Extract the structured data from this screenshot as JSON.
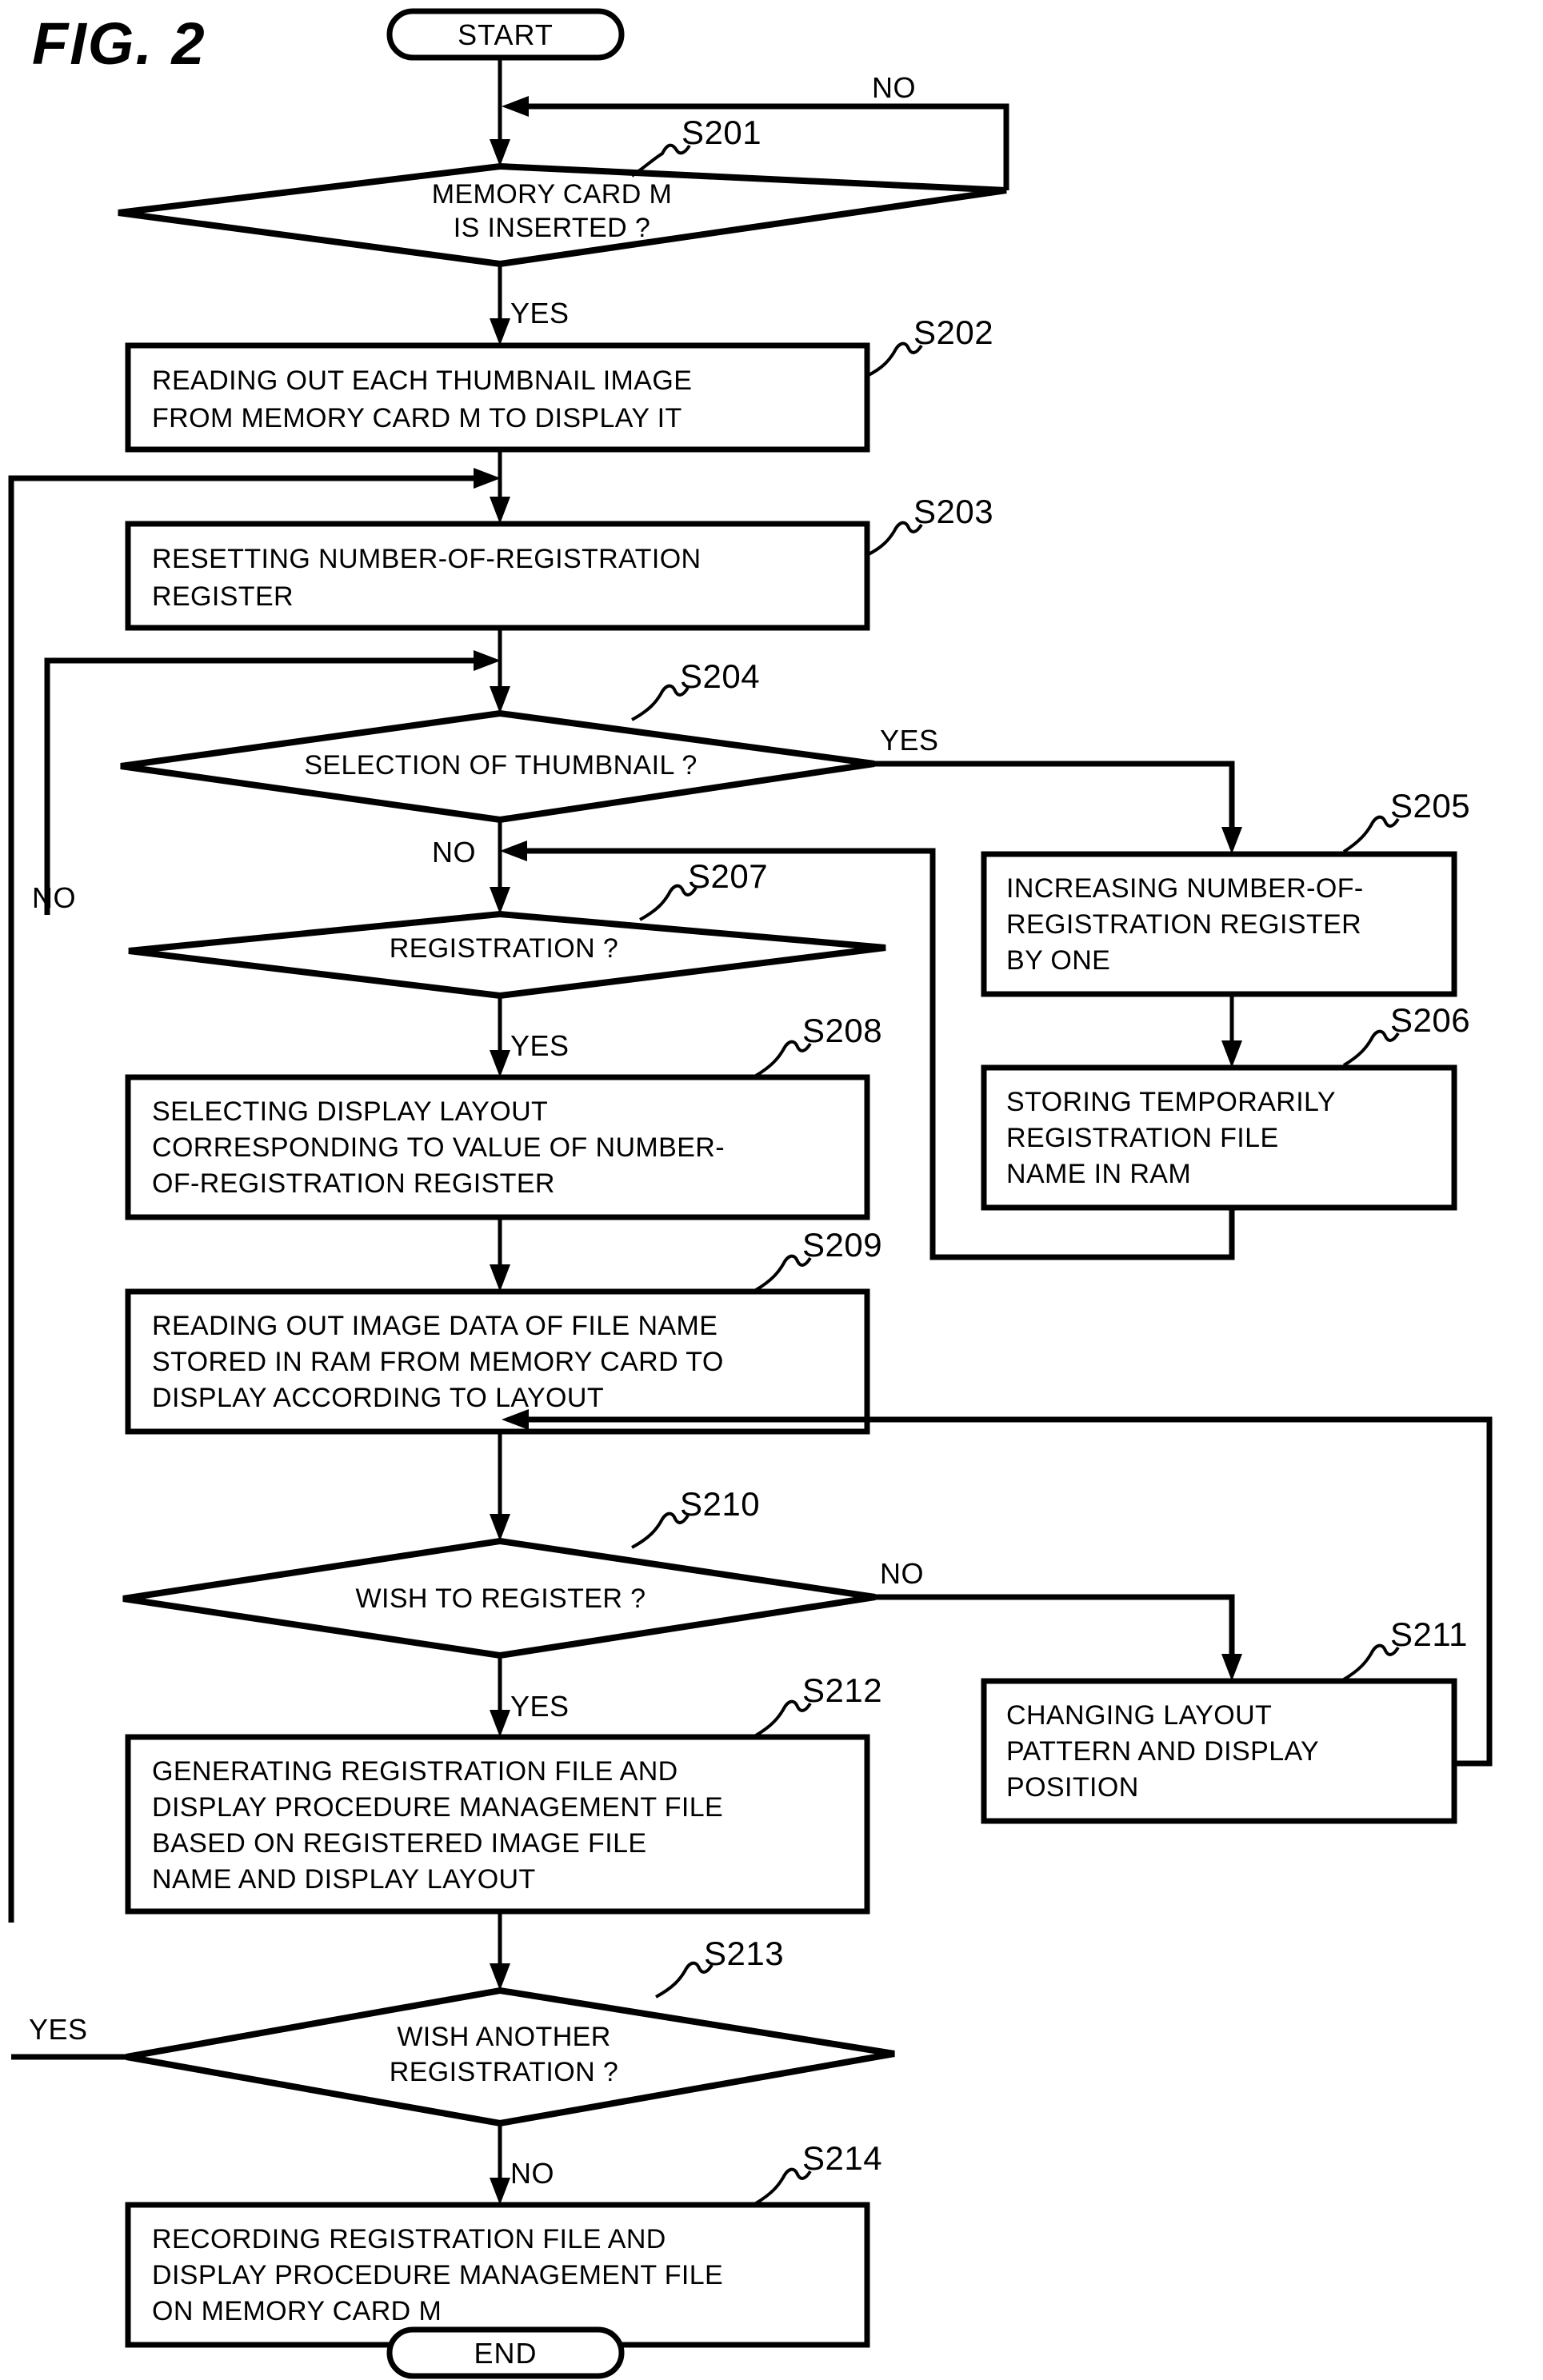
{
  "figure": {
    "label": "FIG. 2",
    "type": "flowchart"
  },
  "terminals": {
    "start": "START",
    "end": "END"
  },
  "nodes": [
    {
      "id": "S201",
      "step": "S201",
      "shape": "decision",
      "lines": [
        "MEMORY CARD M",
        "IS INSERTED ?"
      ]
    },
    {
      "id": "S202",
      "step": "S202",
      "shape": "process",
      "lines": [
        "READING OUT EACH THUMBNAIL IMAGE",
        "FROM MEMORY CARD M TO DISPLAY IT"
      ]
    },
    {
      "id": "S203",
      "step": "S203",
      "shape": "process",
      "lines": [
        "RESETTING NUMBER-OF-REGISTRATION",
        "REGISTER"
      ]
    },
    {
      "id": "S204",
      "step": "S204",
      "shape": "decision",
      "lines": [
        "SELECTION OF THUMBNAIL ?"
      ]
    },
    {
      "id": "S205",
      "step": "S205",
      "shape": "process",
      "lines": [
        "INCREASING NUMBER-OF-",
        "REGISTRATION REGISTER",
        "BY ONE"
      ]
    },
    {
      "id": "S206",
      "step": "S206",
      "shape": "process",
      "lines": [
        "STORING TEMPORARILY",
        "REGISTRATION FILE",
        "NAME IN RAM"
      ]
    },
    {
      "id": "S207",
      "step": "S207",
      "shape": "decision",
      "lines": [
        "REGISTRATION ?"
      ]
    },
    {
      "id": "S208",
      "step": "S208",
      "shape": "process",
      "lines": [
        "SELECTING DISPLAY LAYOUT",
        "CORRESPONDING TO VALUE OF NUMBER-",
        "OF-REGISTRATION REGISTER"
      ]
    },
    {
      "id": "S209",
      "step": "S209",
      "shape": "process",
      "lines": [
        "READING OUT IMAGE DATA OF FILE NAME",
        "STORED IN RAM FROM MEMORY CARD TO",
        "DISPLAY ACCORDING TO LAYOUT"
      ]
    },
    {
      "id": "S210",
      "step": "S210",
      "shape": "decision",
      "lines": [
        "WISH TO REGISTER ?"
      ]
    },
    {
      "id": "S211",
      "step": "S211",
      "shape": "process",
      "lines": [
        "CHANGING LAYOUT",
        "PATTERN AND DISPLAY",
        "POSITION"
      ]
    },
    {
      "id": "S212",
      "step": "S212",
      "shape": "process",
      "lines": [
        "GENERATING REGISTRATION FILE AND",
        "DISPLAY PROCEDURE MANAGEMENT FILE",
        "BASED ON REGISTERED IMAGE FILE",
        "NAME AND DISPLAY LAYOUT"
      ]
    },
    {
      "id": "S213",
      "step": "S213",
      "shape": "decision",
      "lines": [
        "WISH ANOTHER",
        "REGISTRATION ?"
      ]
    },
    {
      "id": "S214",
      "step": "S214",
      "shape": "process",
      "lines": [
        "RECORDING REGISTRATION FILE AND",
        "DISPLAY PROCEDURE MANAGEMENT FILE",
        "ON MEMORY CARD M"
      ]
    }
  ],
  "edge_labels": {
    "s201_no": "NO",
    "s201_yes": "YES",
    "s204_yes": "YES",
    "s204_no": "NO",
    "s207_no": "NO",
    "s207_yes": "YES",
    "s210_no": "NO",
    "s210_yes": "YES",
    "s213_yes": "YES",
    "s213_no": "NO"
  },
  "colors": {
    "ink": "#000000",
    "paper": "#ffffff"
  }
}
